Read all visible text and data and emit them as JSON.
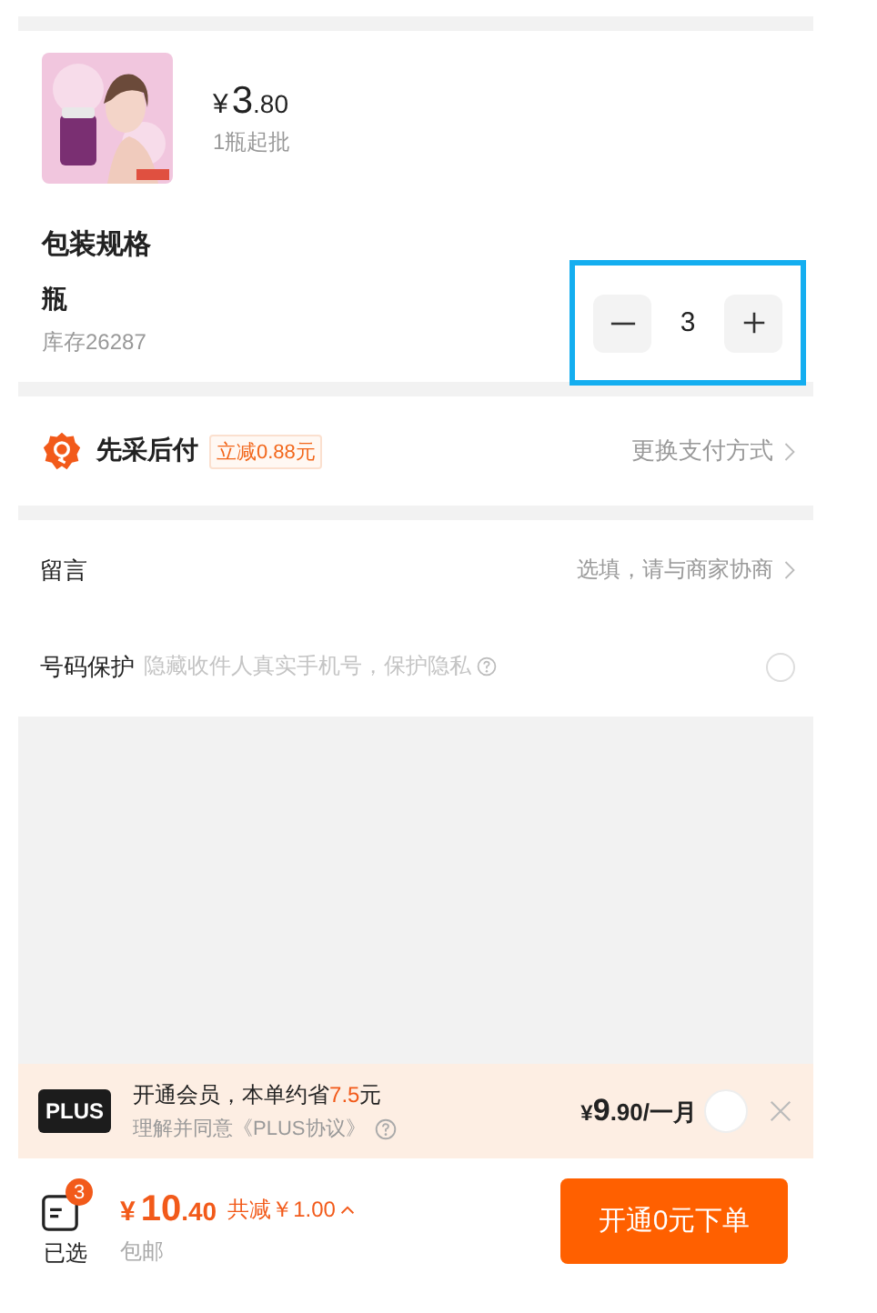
{
  "product": {
    "currency": "¥",
    "price_int": "3",
    "price_dec": ".80",
    "min_order": "1瓶起批",
    "spec_title": "包装规格",
    "spec_name": "瓶",
    "stock": "库存26287",
    "quantity": "3",
    "highlighted": true
  },
  "payment": {
    "title": "先采后付",
    "tag": "立减0.88元",
    "action": "更换支付方式"
  },
  "remark": {
    "label": "留言",
    "placeholder": "选填，请与商家协商"
  },
  "privacy": {
    "label": "号码保护",
    "hint": "隐藏收件人真实手机号，保护隐私",
    "checked": false
  },
  "plus": {
    "logo": "PLUS",
    "text_before": "开通会员，本单约省",
    "saving": "7.5",
    "text_after": "元",
    "agreement": "理解并同意《PLUS协议》",
    "currency": "¥",
    "price_int": "9",
    "price_rest": ".90/一月",
    "checked": false
  },
  "bottom": {
    "badge": "3",
    "selected_label": "已选",
    "currency": "¥",
    "total_int": "10",
    "total_dec": ".40",
    "discount": "共减￥1.00",
    "shipping": "包邮",
    "submit": "开通0元下单"
  }
}
